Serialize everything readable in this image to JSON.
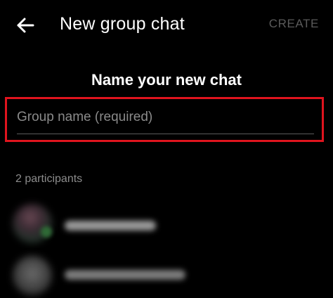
{
  "header": {
    "title": "New group chat",
    "create_label": "CREATE",
    "back_icon": "arrow-left-icon"
  },
  "form": {
    "heading": "Name your new chat",
    "group_name_placeholder": "Group name (required)",
    "group_name_value": "",
    "highlight_color": "#e0141e"
  },
  "participants": {
    "count_label": "2 participants",
    "items": [
      {
        "name": "",
        "avatar": "avatar",
        "online": true
      },
      {
        "name": "",
        "avatar": "avatar",
        "online": false
      }
    ]
  },
  "colors": {
    "background": "#000000",
    "text": "#ffffff",
    "muted": "#8c8c8c",
    "disabled": "#5a5a5a"
  }
}
